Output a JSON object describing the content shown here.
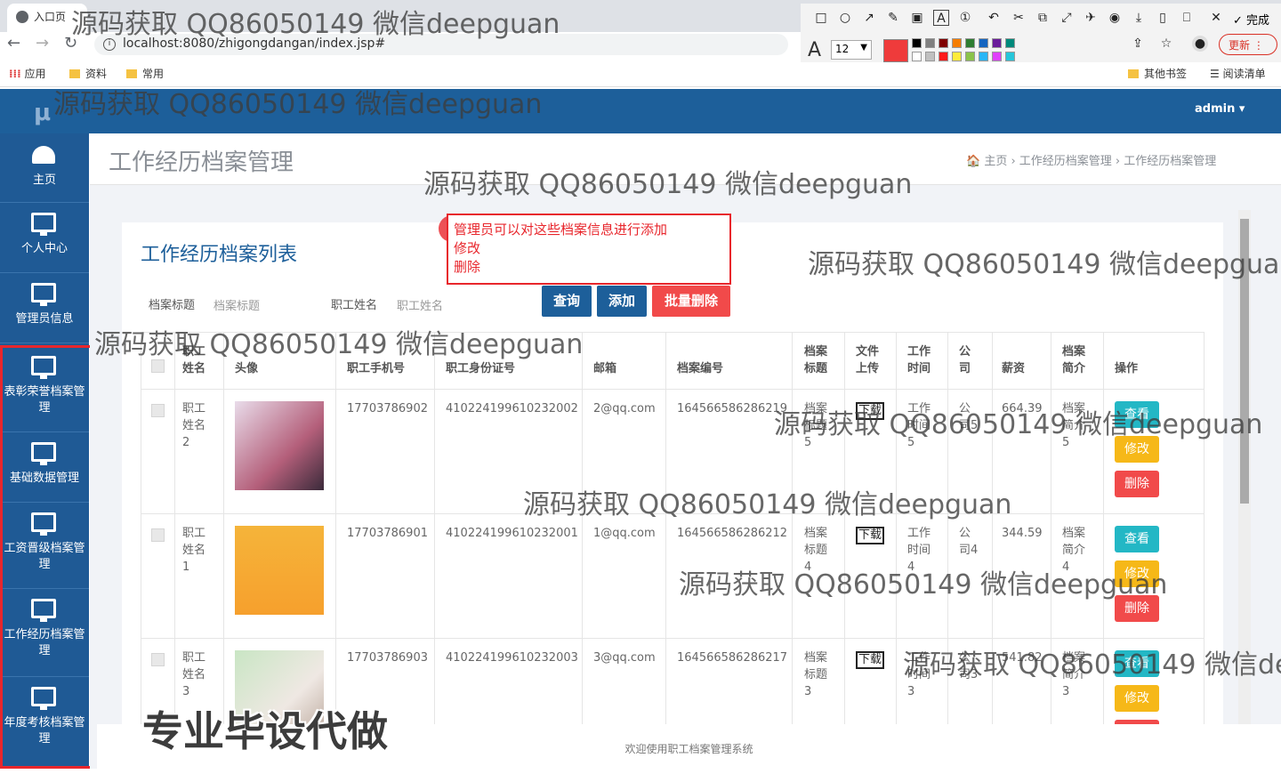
{
  "browser": {
    "tab_title": "入口页",
    "url": "localhost:8080/zhigongdangan/index.jsp#",
    "bookmarks": [
      "应用",
      "资料",
      "常用"
    ],
    "bookmarks_right": [
      "其他书签",
      "阅读清单"
    ],
    "update_label": "更新",
    "done_label": "完成",
    "font_size": "12"
  },
  "header": {
    "logo": "μ",
    "user": "admin ▾"
  },
  "sidebar": {
    "items": [
      {
        "label": "主页",
        "icon": "dashboard-icon"
      },
      {
        "label": "个人中心",
        "icon": "monitor-icon"
      },
      {
        "label": "管理员信息",
        "icon": "monitor-icon"
      },
      {
        "label": "表彰荣誉档案管理",
        "icon": "monitor-icon"
      },
      {
        "label": "基础数据管理",
        "icon": "monitor-icon"
      },
      {
        "label": "工资晋级档案管理",
        "icon": "monitor-icon"
      },
      {
        "label": "工作经历档案管理",
        "icon": "monitor-icon"
      },
      {
        "label": "年度考核档案管理",
        "icon": "monitor-icon"
      }
    ]
  },
  "page": {
    "title": "工作经历档案管理",
    "breadcrumb": "🏠 主页   ›   工作经历档案管理   ›   工作经历档案管理",
    "list_title": "工作经历档案列表"
  },
  "note": {
    "line1": "管理员可以对这些档案信息进行添加",
    "line2": "修改",
    "line3": "删除"
  },
  "filters": {
    "title_label": "档案标题",
    "title_placeholder": "档案标题",
    "name_label": "职工姓名",
    "name_placeholder": "职工姓名"
  },
  "buttons": {
    "search": "查询",
    "add": "添加",
    "batch_delete": "批量删除"
  },
  "table": {
    "headers": [
      "职工\n姓名",
      "头像",
      "职工手机号",
      "职工身份证号",
      "邮箱",
      "档案编号",
      "档案\n标题",
      "文件\n上传",
      "工作\n时间",
      "公\n司",
      "薪资",
      "档案\n简介",
      "操作"
    ],
    "rows": [
      {
        "name": "职工\n姓名\n2",
        "phone": "17703786902",
        "idcard": "410224199610232002",
        "email": "2@qq.com",
        "code": "164566586286219",
        "title": "档案\n标题\n5",
        "file": "下载",
        "time": "工作\n时间\n5",
        "company": "公\n司5",
        "salary": "664.39",
        "intro": "档案\n简介\n5"
      },
      {
        "name": "职工\n姓名\n1",
        "phone": "17703786901",
        "idcard": "410224199610232001",
        "email": "1@qq.com",
        "code": "164566586286212",
        "title": "档案\n标题\n4",
        "file": "下载",
        "time": "工作\n时间\n4",
        "company": "公\n司4",
        "salary": "344.59",
        "intro": "档案\n简介\n4"
      },
      {
        "name": "职工\n姓名\n3",
        "phone": "17703786903",
        "idcard": "410224199610232003",
        "email": "3@qq.com",
        "code": "164566586286217",
        "title": "档案\n标题\n3",
        "file": "下载",
        "time": "工作\n时间\n3",
        "company": "公\n司3",
        "salary": "541.82",
        "intro": "档案\n简介\n3"
      }
    ],
    "actions": {
      "view": "查看",
      "edit": "修改",
      "delete": "删除"
    }
  },
  "footer": "欢迎使用职工档案管理系统",
  "watermark": "源码获取 QQ86050149 微信deepguan",
  "promo": "专业毕设代做",
  "colors": {
    "primary": "#1d5f9a",
    "sidebar": "#1f5a95",
    "view": "#23b7c5",
    "edit": "#f6b818",
    "delete": "#f14a4a",
    "highlight": "#e8262c"
  }
}
